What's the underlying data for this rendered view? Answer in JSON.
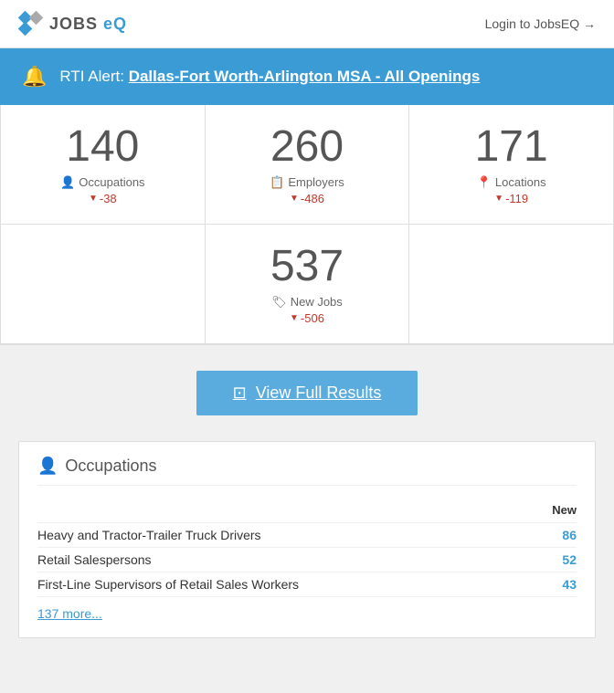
{
  "header": {
    "logo_text": "JOBS",
    "logo_eq": "eQ",
    "login_label": "Login to JobsEQ →"
  },
  "alert": {
    "prefix": "RTI Alert:",
    "link_text": "Dallas-Fort Worth-Arlington MSA - All Openings"
  },
  "stats": [
    {
      "number": "140",
      "label": "Occupations",
      "change": "-38",
      "icon": "👤"
    },
    {
      "number": "260",
      "label": "Employers",
      "change": "-486",
      "icon": "📋"
    },
    {
      "number": "171",
      "label": "Locations",
      "change": "-119",
      "icon": "📍"
    }
  ],
  "stat_bottom": {
    "number": "537",
    "label": "New Jobs",
    "change": "-506",
    "icon": "🏷"
  },
  "button": {
    "label": "View Full Results"
  },
  "occupations_section": {
    "title": "Occupations",
    "col_header": "New",
    "items": [
      {
        "name": "Heavy and Tractor-Trailer Truck Drivers",
        "value": "86"
      },
      {
        "name": "Retail Salespersons",
        "value": "52"
      },
      {
        "name": "First-Line Supervisors of Retail Sales Workers",
        "value": "43"
      }
    ],
    "more_label": "137 more..."
  }
}
